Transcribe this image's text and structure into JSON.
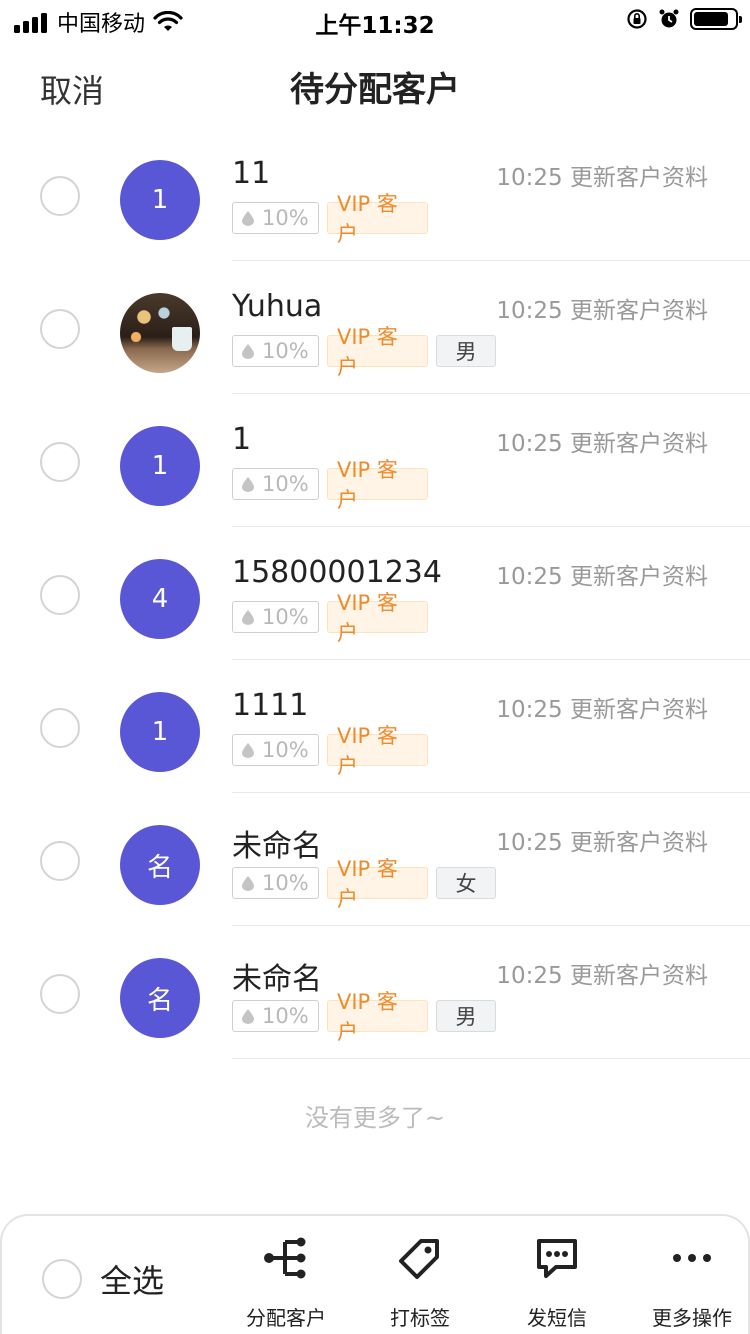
{
  "status_bar": {
    "carrier": "中国移动",
    "time": "上午11:32",
    "battery_level": 0.85
  },
  "nav": {
    "cancel": "取消",
    "title": "待分配客户"
  },
  "customers": [
    {
      "avatar_text": "1",
      "name": "11",
      "update": "10:25 更新客户资料",
      "percent": "10%",
      "vip": "VIP 客户",
      "gender": ""
    },
    {
      "avatar_text": "",
      "avatar_image": true,
      "name": "Yuhua",
      "update": "10:25 更新客户资料",
      "percent": "10%",
      "vip": "VIP 客户",
      "gender": "男"
    },
    {
      "avatar_text": "1",
      "name": "1",
      "update": "10:25 更新客户资料",
      "percent": "10%",
      "vip": "VIP 客户",
      "gender": ""
    },
    {
      "avatar_text": "4",
      "name": "15800001234",
      "update": "10:25 更新客户资料",
      "percent": "10%",
      "vip": "VIP 客户",
      "gender": ""
    },
    {
      "avatar_text": "1",
      "name": "1111",
      "update": "10:25 更新客户资料",
      "percent": "10%",
      "vip": "VIP 客户",
      "gender": ""
    },
    {
      "avatar_text": "名",
      "name": "未命名",
      "update": "10:25 更新客户资料",
      "percent": "10%",
      "vip": "VIP 客户",
      "gender": "女"
    },
    {
      "avatar_text": "名",
      "name": "未命名",
      "update": "10:25 更新客户资料",
      "percent": "10%",
      "vip": "VIP 客户",
      "gender": "男"
    }
  ],
  "no_more": "没有更多了~",
  "toolbar": {
    "select_all": "全选",
    "actions": [
      {
        "label": "分配客户",
        "icon": "assign-icon"
      },
      {
        "label": "打标签",
        "icon": "tag-icon"
      },
      {
        "label": "发短信",
        "icon": "sms-icon"
      },
      {
        "label": "更多操作",
        "icon": "more-icon"
      }
    ]
  },
  "colors": {
    "avatar": "#5a57d6",
    "vip_text": "#f08a2a",
    "vip_bg": "#fff4e5"
  }
}
